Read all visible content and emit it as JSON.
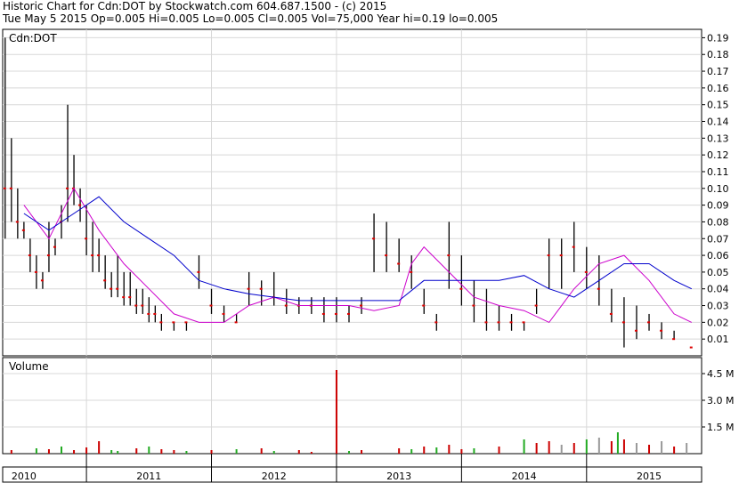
{
  "header": {
    "line1": "Historic Chart for Cdn:DOT by Stockwatch.com 604.687.1500 - (c) 2015",
    "line2": "Tue May  5 2015  Op=0.005  Hi=0.005  Lo=0.005  Cl=0.005  Vol=75,000  Year hi=0.19  lo=0.005"
  },
  "chart_data": [
    {
      "type": "ohlc",
      "panel_label": "Cdn:DOT",
      "ylim": [
        0,
        0.195
      ],
      "yticks": [
        "0.19",
        "0.18",
        "0.17",
        "0.16",
        "0.15",
        "0.14",
        "0.13",
        "0.12",
        "0.11",
        "0.10",
        "0.09",
        "0.08",
        "0.07",
        "0.06",
        "0.05",
        "0.04",
        "0.03",
        "0.02",
        "0.01"
      ],
      "x": [
        2009.85,
        2009.9,
        2009.95,
        2010.0,
        2010.05,
        2010.1,
        2010.15,
        2010.2,
        2010.25,
        2010.3,
        2010.35,
        2010.4,
        2010.45,
        2010.5,
        2010.55,
        2010.6,
        2010.65,
        2010.7,
        2010.75,
        2010.8,
        2010.85,
        2010.9,
        2010.95,
        2011.0,
        2011.05,
        2011.1,
        2011.2,
        2011.3,
        2011.4,
        2011.5,
        2011.6,
        2011.7,
        2011.8,
        2011.9,
        2012.0,
        2012.1,
        2012.2,
        2012.3,
        2012.4,
        2012.5,
        2012.6,
        2012.7,
        2012.8,
        2012.9,
        2013.0,
        2013.1,
        2013.2,
        2013.3,
        2013.4,
        2013.5,
        2013.6,
        2013.7,
        2013.8,
        2013.9,
        2014.0,
        2014.1,
        2014.2,
        2014.3,
        2014.4,
        2014.5,
        2014.6,
        2014.7,
        2014.8,
        2014.9,
        2015.0,
        2015.1,
        2015.2,
        2015.34
      ],
      "high": [
        0.19,
        0.13,
        0.1,
        0.08,
        0.07,
        0.06,
        0.05,
        0.08,
        0.07,
        0.09,
        0.15,
        0.12,
        0.1,
        0.09,
        0.08,
        0.07,
        0.06,
        0.05,
        0.06,
        0.05,
        0.05,
        0.04,
        0.04,
        0.035,
        0.03,
        0.025,
        0.02,
        0.02,
        0.06,
        0.04,
        0.03,
        0.025,
        0.05,
        0.045,
        0.05,
        0.04,
        0.035,
        0.035,
        0.035,
        0.035,
        0.03,
        0.035,
        0.085,
        0.08,
        0.07,
        0.06,
        0.04,
        0.025,
        0.08,
        0.06,
        0.045,
        0.04,
        0.03,
        0.025,
        0.02,
        0.04,
        0.07,
        0.07,
        0.08,
        0.065,
        0.06,
        0.04,
        0.035,
        0.03,
        0.025,
        0.02,
        0.015,
        0.005
      ],
      "low": [
        0.07,
        0.08,
        0.07,
        0.07,
        0.05,
        0.04,
        0.04,
        0.05,
        0.06,
        0.07,
        0.08,
        0.09,
        0.08,
        0.06,
        0.05,
        0.05,
        0.04,
        0.035,
        0.035,
        0.03,
        0.03,
        0.025,
        0.025,
        0.02,
        0.02,
        0.015,
        0.015,
        0.015,
        0.04,
        0.025,
        0.02,
        0.02,
        0.03,
        0.03,
        0.03,
        0.025,
        0.025,
        0.025,
        0.02,
        0.02,
        0.02,
        0.025,
        0.05,
        0.05,
        0.05,
        0.04,
        0.025,
        0.015,
        0.04,
        0.03,
        0.02,
        0.015,
        0.015,
        0.015,
        0.015,
        0.025,
        0.04,
        0.04,
        0.05,
        0.04,
        0.03,
        0.02,
        0.005,
        0.01,
        0.015,
        0.01,
        0.01,
        0.005
      ],
      "close": [
        0.1,
        0.1,
        0.08,
        0.075,
        0.06,
        0.05,
        0.045,
        0.06,
        0.065,
        0.08,
        0.1,
        0.1,
        0.09,
        0.07,
        0.06,
        0.06,
        0.045,
        0.04,
        0.04,
        0.035,
        0.035,
        0.03,
        0.03,
        0.025,
        0.025,
        0.02,
        0.02,
        0.02,
        0.05,
        0.03,
        0.025,
        0.02,
        0.04,
        0.04,
        0.035,
        0.03,
        0.03,
        0.03,
        0.025,
        0.025,
        0.025,
        0.03,
        0.07,
        0.06,
        0.055,
        0.05,
        0.03,
        0.02,
        0.06,
        0.04,
        0.03,
        0.02,
        0.02,
        0.02,
        0.02,
        0.03,
        0.06,
        0.06,
        0.065,
        0.05,
        0.04,
        0.025,
        0.02,
        0.015,
        0.02,
        0.015,
        0.01,
        0.005
      ],
      "series": [
        {
          "name": "",
          "color": "#cc00cc",
          "x": [
            2010.0,
            2010.2,
            2010.4,
            2010.6,
            2010.8,
            2011.0,
            2011.2,
            2011.4,
            2011.6,
            2011.8,
            2012.0,
            2012.2,
            2012.4,
            2012.6,
            2012.8,
            2013.0,
            2013.1,
            2013.2,
            2013.4,
            2013.6,
            2013.8,
            2014.0,
            2014.2,
            2014.4,
            2014.6,
            2014.8,
            2015.0,
            2015.2,
            2015.34
          ],
          "values": [
            0.09,
            0.07,
            0.1,
            0.075,
            0.055,
            0.04,
            0.025,
            0.02,
            0.02,
            0.03,
            0.035,
            0.03,
            0.03,
            0.03,
            0.027,
            0.03,
            0.055,
            0.065,
            0.05,
            0.035,
            0.03,
            0.027,
            0.02,
            0.04,
            0.055,
            0.06,
            0.045,
            0.025,
            0.02
          ]
        },
        {
          "name": "",
          "color": "#0000cc",
          "x": [
            2010.0,
            2010.2,
            2010.4,
            2010.6,
            2010.8,
            2011.0,
            2011.2,
            2011.4,
            2011.6,
            2011.8,
            2012.0,
            2012.2,
            2012.4,
            2012.6,
            2012.8,
            2013.0,
            2013.2,
            2013.4,
            2013.6,
            2013.8,
            2014.0,
            2014.2,
            2014.4,
            2014.6,
            2014.8,
            2015.0,
            2015.2,
            2015.34
          ],
          "values": [
            0.085,
            0.075,
            0.085,
            0.095,
            0.08,
            0.07,
            0.06,
            0.045,
            0.04,
            0.037,
            0.035,
            0.033,
            0.033,
            0.033,
            0.033,
            0.033,
            0.045,
            0.045,
            0.045,
            0.045,
            0.048,
            0.04,
            0.035,
            0.045,
            0.055,
            0.055,
            0.045,
            0.04
          ]
        }
      ]
    },
    {
      "type": "bar",
      "panel_label": "Volume",
      "ylim": [
        0,
        5000000
      ],
      "yticks": [
        "4.5 M",
        "3.0 M",
        "1.5 M"
      ],
      "ytick_values": [
        4500000,
        3000000,
        1500000
      ],
      "x": [
        2009.9,
        2010.1,
        2010.2,
        2010.3,
        2010.4,
        2010.5,
        2010.6,
        2010.7,
        2010.75,
        2010.9,
        2011.0,
        2011.1,
        2011.2,
        2011.3,
        2011.5,
        2011.7,
        2011.9,
        2012.0,
        2012.2,
        2012.3,
        2012.5,
        2012.6,
        2012.7,
        2013.0,
        2013.1,
        2013.2,
        2013.3,
        2013.4,
        2013.5,
        2013.6,
        2013.8,
        2014.0,
        2014.1,
        2014.2,
        2014.3,
        2014.4,
        2014.5,
        2014.6,
        2014.7,
        2014.75,
        2014.8,
        2014.9,
        2015.0,
        2015.1,
        2015.2,
        2015.3
      ],
      "values": [
        200000,
        300000,
        250000,
        400000,
        200000,
        350000,
        700000,
        200000,
        150000,
        300000,
        400000,
        250000,
        200000,
        150000,
        200000,
        250000,
        300000,
        150000,
        200000,
        100000,
        4700000,
        150000,
        200000,
        300000,
        250000,
        400000,
        350000,
        500000,
        250000,
        300000,
        400000,
        800000,
        600000,
        700000,
        500000,
        600000,
        800000,
        900000,
        700000,
        1200000,
        800000,
        600000,
        500000,
        700000,
        400000,
        600000
      ],
      "colors": [
        "#cc0000",
        "#22aa22",
        "#cc0000",
        "#22aa22",
        "#cc0000",
        "#cc0000",
        "#cc0000",
        "#22aa22",
        "#22aa22",
        "#cc0000",
        "#22aa22",
        "#cc0000",
        "#cc0000",
        "#22aa22",
        "#cc0000",
        "#22aa22",
        "#cc0000",
        "#22aa22",
        "#cc0000",
        "#cc0000",
        "#cc0000",
        "#22aa22",
        "#cc0000",
        "#cc0000",
        "#22aa22",
        "#cc0000",
        "#22aa22",
        "#cc0000",
        "#cc0000",
        "#22aa22",
        "#cc0000",
        "#22aa22",
        "#cc0000",
        "#cc0000",
        "#999999",
        "#cc0000",
        "#22aa22",
        "#999999",
        "#cc0000",
        "#22aa22",
        "#cc0000",
        "#999999",
        "#cc0000",
        "#999999",
        "#cc0000",
        "#999999"
      ]
    }
  ],
  "x_axis": {
    "range": [
      2009.83,
      2015.42
    ],
    "ticks": [
      {
        "label": "2010",
        "pos": 2010.0,
        "span": [
          2009.83,
          2010.5
        ]
      },
      {
        "label": "2011",
        "pos": 2011.0,
        "span": [
          2010.5,
          2011.5
        ]
      },
      {
        "label": "2012",
        "pos": 2012.0,
        "span": [
          2011.5,
          2012.5
        ]
      },
      {
        "label": "2013",
        "pos": 2013.0,
        "span": [
          2012.5,
          2013.5
        ]
      },
      {
        "label": "2014",
        "pos": 2014.0,
        "span": [
          2013.5,
          2014.5
        ]
      },
      {
        "label": "2015",
        "pos": 2015.0,
        "span": [
          2014.5,
          2015.42
        ]
      }
    ],
    "year_boundaries": [
      2010.5,
      2011.5,
      2012.5,
      2013.5,
      2014.5
    ]
  }
}
